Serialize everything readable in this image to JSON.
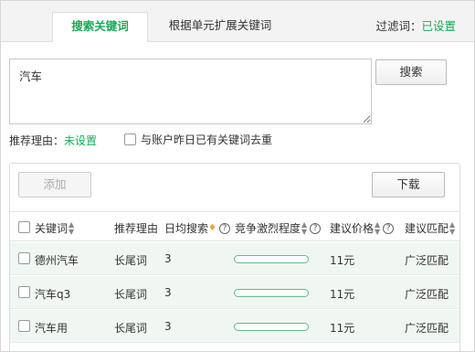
{
  "tabs": [
    {
      "label": "搜索关键词"
    },
    {
      "label": "根据单元扩展关键词"
    }
  ],
  "filter": {
    "label": "过滤词：",
    "value": "已设置"
  },
  "search": {
    "value": "汽车",
    "button": "搜索"
  },
  "reason": {
    "label": "推荐理由：",
    "value": "未设置"
  },
  "dedup": {
    "label": "与账户昨日已有关键词去重"
  },
  "actions": {
    "add": "添加",
    "download": "下载"
  },
  "columns": {
    "keyword": "关键词",
    "reason": "推荐理由",
    "daily": "日均搜索",
    "competition": "竞争激烈程度",
    "price": "建议价格",
    "match": "建议匹配"
  },
  "rows": [
    {
      "keyword": "德州汽车",
      "reason": "长尾词",
      "daily": "3",
      "competition": 0.0,
      "price": "11元",
      "match": "广泛匹配"
    },
    {
      "keyword": "汽车q3",
      "reason": "长尾词",
      "daily": "3",
      "competition": 0.0,
      "price": "11元",
      "match": "广泛匹配"
    },
    {
      "keyword": "汽车用",
      "reason": "长尾词",
      "daily": "3",
      "competition": 0.0,
      "price": "11元",
      "match": "广泛匹配"
    }
  ],
  "colors": {
    "accent": "#1aaa55",
    "row_bg": "#f0f7f2",
    "bar_border": "#5cc08a"
  }
}
